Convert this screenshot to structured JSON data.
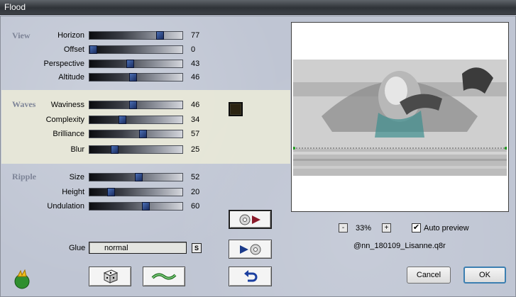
{
  "window": {
    "title": "Flood"
  },
  "sections": {
    "view": "View",
    "waves": "Waves",
    "ripple": "Ripple"
  },
  "sliders": {
    "view": [
      {
        "label": "Horizon",
        "value": "77",
        "level": 0.77
      },
      {
        "label": "Offset",
        "value": "0",
        "level": 0.0
      },
      {
        "label": "Perspective",
        "value": "43",
        "level": 0.43
      },
      {
        "label": "Altitude",
        "value": "46",
        "level": 0.46
      }
    ],
    "waves": [
      {
        "label": "Waviness",
        "value": "46",
        "level": 0.46
      },
      {
        "label": "Complexity",
        "value": "34",
        "level": 0.34
      },
      {
        "label": "Brilliance",
        "value": "57",
        "level": 0.57
      },
      {
        "label": "Blur",
        "value": "25",
        "level": 0.25
      }
    ],
    "ripple": [
      {
        "label": "Size",
        "value": "52",
        "level": 0.52
      },
      {
        "label": "Height",
        "value": "20",
        "level": 0.2
      },
      {
        "label": "Undulation",
        "value": "60",
        "level": 0.6
      }
    ]
  },
  "color": {
    "swatch": "#2b2412"
  },
  "glue": {
    "label": "Glue",
    "value": "normal",
    "s_button": "S"
  },
  "preview": {
    "zoom_minus": "-",
    "zoom_value": "33%",
    "zoom_plus": "+",
    "auto_preview_label": "Auto preview",
    "auto_preview_checked": true,
    "checkmark": "✔",
    "preset_name": "@nn_180109_Lisanne.q8r"
  },
  "buttons": {
    "cancel": "Cancel",
    "ok": "OK"
  },
  "icons": {
    "app": "gear-flame-icon",
    "random": "dice-icon",
    "wave": "wave-icon",
    "reset": "undo-icon",
    "save_preset": "disc-play-icon",
    "load_preset": "play-disc-icon"
  }
}
